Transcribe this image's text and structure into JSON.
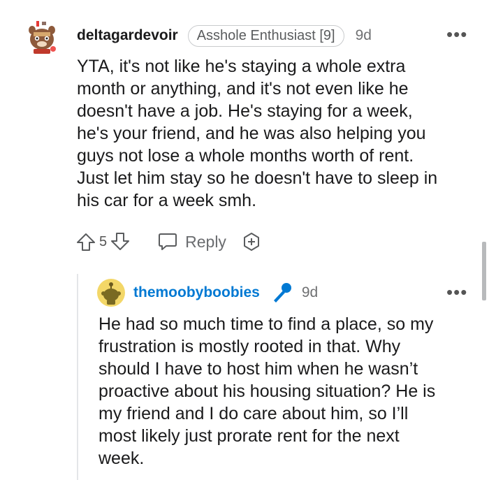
{
  "comment": {
    "username": "deltagardevoir",
    "flair": "Asshole Enthusiast [9]",
    "timestamp": "9d",
    "more_label": "•••",
    "lines": [
      "YTA, it's not like he's staying a whole extra",
      "month or anything, and it's not even like he",
      "doesn't have a job. He's staying for a week,",
      "he's your friend, and he was also helping you",
      "guys not lose a whole months worth of rent.",
      "Just let him stay so he doesn't have to sleep in",
      "his car for a week smh."
    ],
    "vote_count": "5",
    "reply_label": "Reply"
  },
  "reply": {
    "username": "themoobyboobies",
    "timestamp": "9d",
    "more_label": "•••",
    "lines": [
      "He had so much time to find a place, so my",
      "frustration is mostly rooted in that. Why",
      "should I have to host him when he wasn’t",
      "proactive about his housing situation? He is",
      "my friend and I do care about him, so I’ll",
      "most likely just prorate rent for the next",
      "week."
    ]
  },
  "colors": {
    "op_blue": "#0079d3",
    "text": "#1a1a1b",
    "muted": "#6f7072",
    "flair_border": "#c9cbcd"
  },
  "icons": {
    "upvote": "arrow-up-icon",
    "downvote": "arrow-down-icon",
    "reply": "speech-bubble-icon",
    "award": "plus-award-icon",
    "mic": "microphone-icon"
  }
}
